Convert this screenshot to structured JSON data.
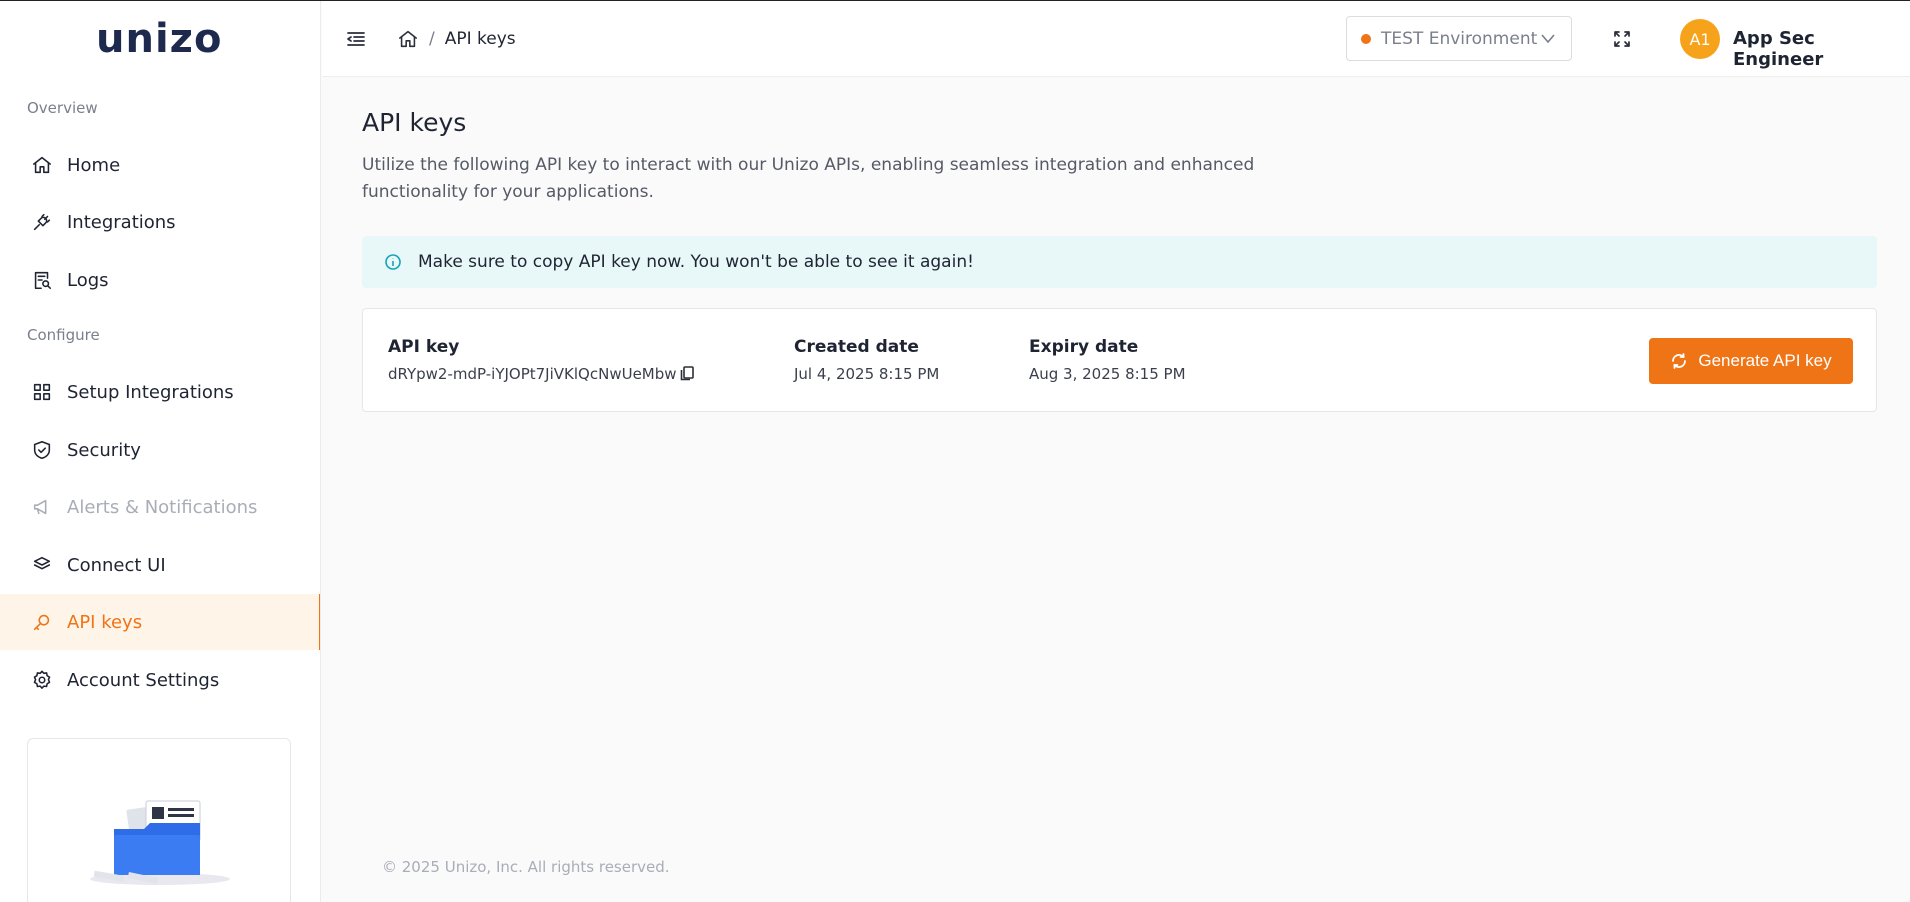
{
  "brand": {
    "logo_text": "unizo",
    "accent": "#ef7416"
  },
  "sidebar": {
    "sections": [
      {
        "label": "Overview"
      },
      {
        "label": "Configure"
      }
    ],
    "items": [
      {
        "label": "Home",
        "icon": "home-icon"
      },
      {
        "label": "Integrations",
        "icon": "plug-icon"
      },
      {
        "label": "Logs",
        "icon": "log-search-icon"
      },
      {
        "label": "Setup Integrations",
        "icon": "grid-icon"
      },
      {
        "label": "Security",
        "icon": "shield-check-icon"
      },
      {
        "label": "Alerts & Notifications",
        "icon": "megaphone-icon",
        "disabled": true
      },
      {
        "label": "Connect UI",
        "icon": "layers-icon"
      },
      {
        "label": "API keys",
        "icon": "key-icon",
        "active": true
      },
      {
        "label": "Account Settings",
        "icon": "gear-icon"
      }
    ]
  },
  "header": {
    "breadcrumb": {
      "current": "API keys",
      "separator": "/"
    },
    "environment": {
      "label": "TEST Environment",
      "status_color": "#ef7416"
    },
    "user": {
      "initials": "A1",
      "name": "App Sec Engineer"
    }
  },
  "main": {
    "title": "API keys",
    "description": "Utilize the following API key to interact with our Unizo APIs, enabling seamless integration and enhanced functionality for your applications.",
    "alert": "Make sure to copy API key now. You won't be able to see it again!",
    "key": {
      "key_label": "API key",
      "key_value": "dRYpw2-mdP-iYJOPt7JiVKlQcNwUeMbw",
      "created_label": "Created date",
      "created_value": "Jul 4, 2025 8:15 PM",
      "expiry_label": "Expiry date",
      "expiry_value": "Aug 3, 2025 8:15 PM"
    },
    "generate_button": "Generate API key"
  },
  "footer": {
    "copyright": "© 2025 Unizo, Inc. All rights reserved."
  }
}
